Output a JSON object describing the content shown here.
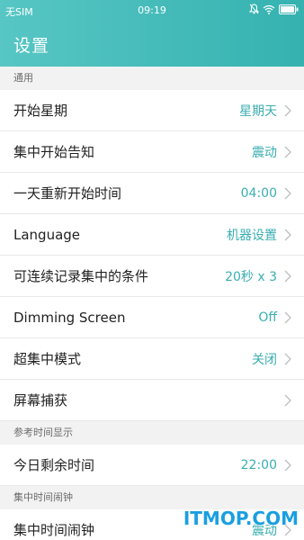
{
  "status_bar": {
    "carrier": "无SIM",
    "time": "09:19"
  },
  "app_bar": {
    "title": "设置"
  },
  "sections": {
    "general": "通用",
    "reference_time": "参考时间显示",
    "focus_alarm": "集中时间闹钟"
  },
  "rows": {
    "week_start": {
      "label": "开始星期",
      "value": "星期天"
    },
    "focus_notify": {
      "label": "集中开始告知",
      "value": "震动"
    },
    "day_restart": {
      "label": "一天重新开始时间",
      "value": "04:00"
    },
    "language": {
      "label": "Language",
      "value": "机器设置"
    },
    "record_condition": {
      "label": "可连续记录集中的条件",
      "value": "20秒 x 3"
    },
    "dimming": {
      "label": "Dimming Screen",
      "value": "Off"
    },
    "super_focus": {
      "label": "超集中模式",
      "value": "关闭"
    },
    "screen_capture": {
      "label": "屏幕捕获",
      "value": ""
    },
    "remaining_time": {
      "label": "今日剩余时间",
      "value": "22:00"
    },
    "focus_alarm": {
      "label": "集中时间闹钟",
      "value": "震动"
    }
  },
  "watermark": "ITMOP.COM",
  "colors": {
    "header_start": "#57c6c4",
    "header_end": "#35b2b0",
    "value_text": "#3aaeb0",
    "watermark": "#1a9fe0"
  },
  "icons": {
    "status": [
      "mute-icon",
      "wifi-icon",
      "battery-icon"
    ],
    "row_trailing": "chevron-right-icon"
  }
}
